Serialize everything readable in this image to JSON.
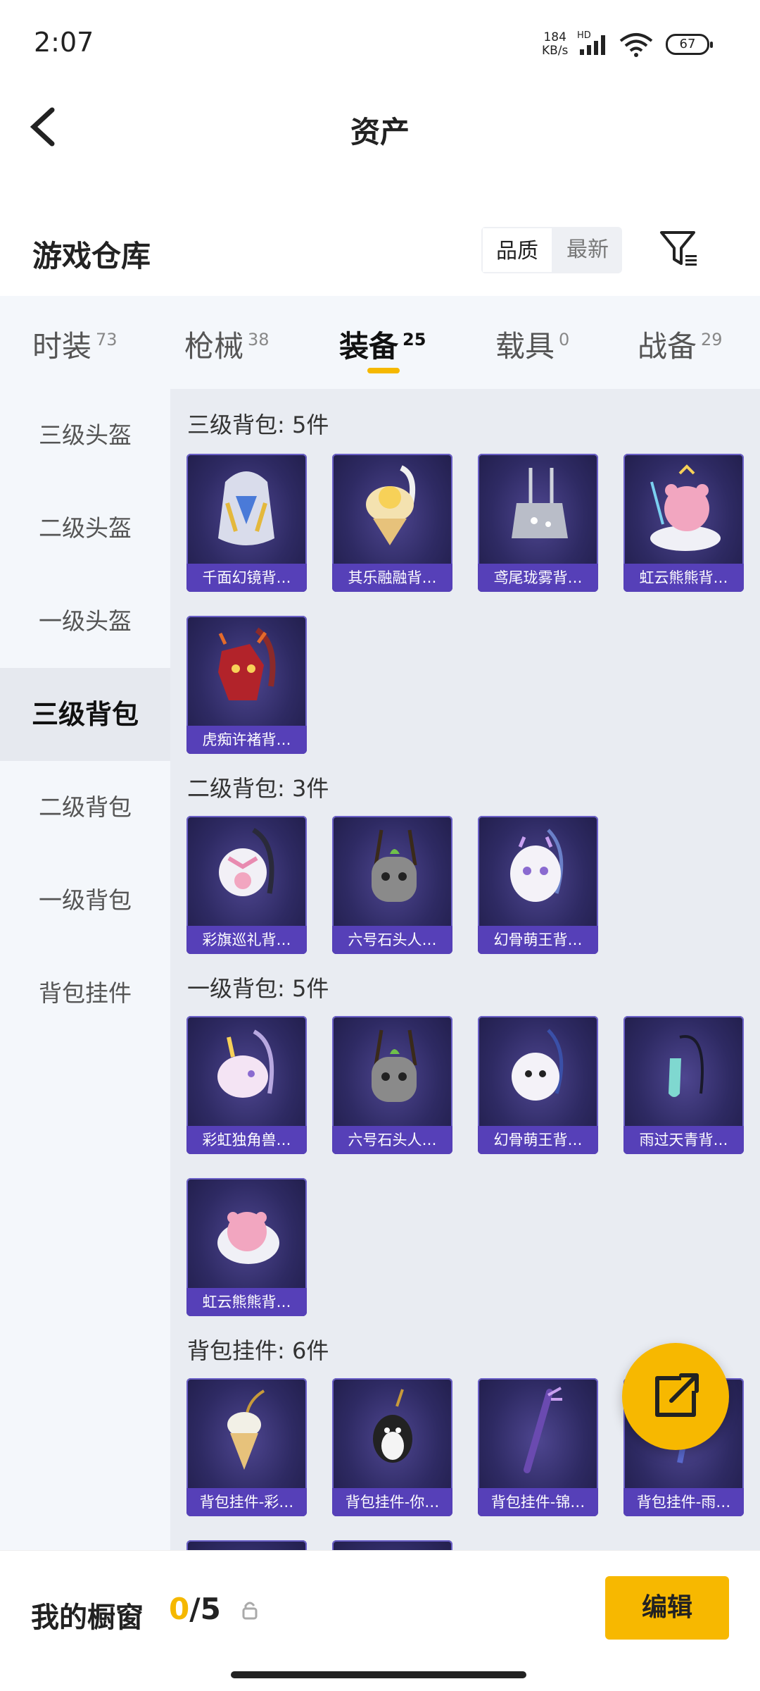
{
  "status_bar": {
    "time": "2:07",
    "net_speed": "184",
    "net_unit": "KB/s",
    "hd": "HD",
    "battery": "67"
  },
  "header": {
    "title": "资产",
    "back_icon": "chevron-left-icon"
  },
  "warehouse": {
    "title": "游戏仓库",
    "sort_options": [
      "品质",
      "最新"
    ],
    "sort_selected": "品质",
    "filter_icon": "filter-icon"
  },
  "tabs": [
    {
      "label": "时装",
      "count": "73"
    },
    {
      "label": "枪械",
      "count": "38"
    },
    {
      "label": "装备",
      "count": "25",
      "active": true
    },
    {
      "label": "载具",
      "count": "0"
    },
    {
      "label": "战备",
      "count": "29"
    }
  ],
  "sidebar": {
    "items": [
      "三级头盔",
      "二级头盔",
      "一级头盔",
      "三级背包",
      "二级背包",
      "一级背包",
      "背包挂件"
    ],
    "active": "三级背包"
  },
  "sections": [
    {
      "title": "三级背包: 5件",
      "items": [
        "千面幻镜背…",
        "其乐融融背…",
        "鸢尾珑雾背…",
        "虹云熊熊背…",
        "虎痴许褚背…"
      ]
    },
    {
      "title": "二级背包: 3件",
      "items": [
        "彩旗巡礼背…",
        "六号石头人…",
        "幻骨萌王背…"
      ]
    },
    {
      "title": "一级背包: 5件",
      "items": [
        "彩虹独角兽…",
        "六号石头人…",
        "幻骨萌王背…",
        "雨过天青背…",
        "虹云熊熊背…"
      ]
    },
    {
      "title": "背包挂件: 6件",
      "items": [
        "背包挂件-彩…",
        "背包挂件-你…",
        "背包挂件-锦…",
        "背包挂件-雨…"
      ]
    }
  ],
  "bottom_bar": {
    "label": "我的橱窗",
    "count_current": "0",
    "count_total": "/5",
    "edit_label": "编辑"
  },
  "colors": {
    "accent": "#f7b800",
    "card_bg": "#2e2a63",
    "card_label": "#5640b8"
  }
}
